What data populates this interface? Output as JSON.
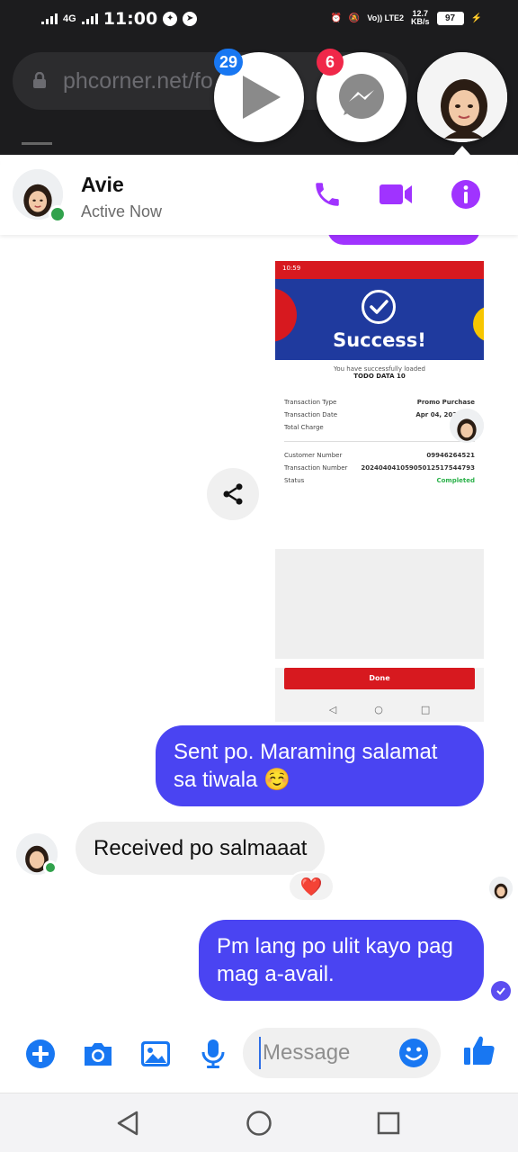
{
  "status_bar": {
    "time": "11:00",
    "network": "4G",
    "volte": "Vo)) LTE2",
    "speed_value": "12.7",
    "speed_unit": "KB/s",
    "battery": "97"
  },
  "browser": {
    "url": "phcorner.net/fo"
  },
  "chat_heads": [
    {
      "name": "video-chathead",
      "badge": "29",
      "badge_color": "#1877f2"
    },
    {
      "name": "messenger-chathead",
      "badge": "6",
      "badge_color": "#f02849"
    },
    {
      "name": "contact-chathead",
      "badge": "",
      "badge_color": ""
    }
  ],
  "header": {
    "name": "Avie",
    "status": "Active Now",
    "accent": "#a033ff"
  },
  "attachment": {
    "status_time": "10:59",
    "title": "Success!",
    "lead": "You have successfully loaded",
    "product": "TODO DATA 10",
    "rows": [
      {
        "label": "Transaction Type",
        "value": "Promo Purchase"
      },
      {
        "label": "Transaction Date",
        "value": "Apr 04, 2024  10:"
      },
      {
        "label": "Total Charge",
        "value": ""
      }
    ],
    "rows2": [
      {
        "label": "Customer Number",
        "value": "09946264521"
      },
      {
        "label": "Transaction Number",
        "value": "20240404105905012517544793"
      },
      {
        "label": "Status",
        "value": "Completed"
      }
    ],
    "done_label": "Done"
  },
  "messages": [
    {
      "direction": "out",
      "text": "Sent po. Maraming salamat sa tiwala ☺️"
    },
    {
      "direction": "in",
      "text": "Received po salmaaat",
      "reaction": "❤️"
    },
    {
      "direction": "out",
      "text": "Pm lang po ulit kayo pag mag a-avail."
    }
  ],
  "composer": {
    "placeholder": "Message"
  },
  "colors": {
    "outgoing_bubble": "#4a44f2",
    "incoming_bubble": "#efefef",
    "messenger_blue": "#1877f2"
  }
}
